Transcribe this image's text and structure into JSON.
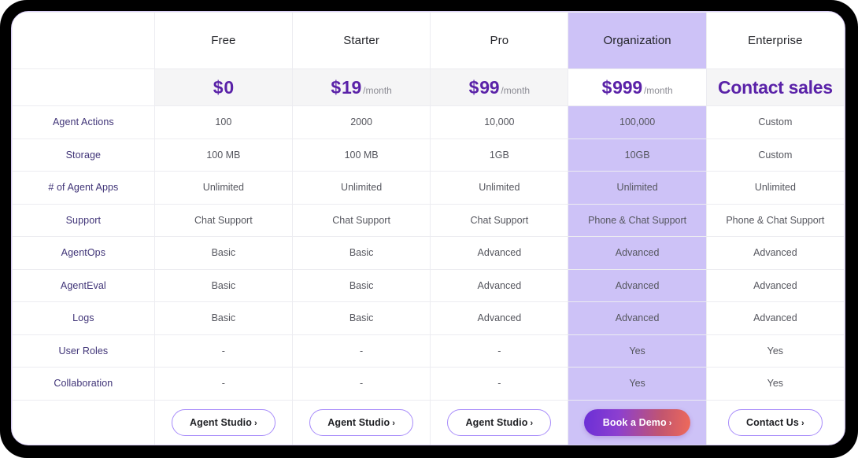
{
  "table": {
    "label_column_header": "",
    "plans": [
      {
        "name": "Free",
        "highlight": false,
        "currency": "$",
        "amount": "0",
        "period": "",
        "contact_text": ""
      },
      {
        "name": "Starter",
        "highlight": false,
        "currency": "$",
        "amount": "19",
        "period": "/month",
        "contact_text": ""
      },
      {
        "name": "Pro",
        "highlight": false,
        "currency": "$",
        "amount": "99",
        "period": "/month",
        "contact_text": ""
      },
      {
        "name": "Organization",
        "highlight": true,
        "currency": "$",
        "amount": "999",
        "period": "/month",
        "contact_text": ""
      },
      {
        "name": "Enterprise",
        "highlight": false,
        "currency": "",
        "amount": "",
        "period": "",
        "contact_text": "Contact sales"
      }
    ],
    "features": [
      {
        "label": "Agent Actions",
        "values": [
          "100",
          "2000",
          "10,000",
          "100,000",
          "Custom"
        ]
      },
      {
        "label": "Storage",
        "values": [
          "100 MB",
          "100 MB",
          "1GB",
          "10GB",
          "Custom"
        ]
      },
      {
        "label": "# of Agent Apps",
        "values": [
          "Unlimited",
          "Unlimited",
          "Unlimited",
          "Unlimited",
          "Unlimited"
        ]
      },
      {
        "label": "Support",
        "values": [
          "Chat Support",
          "Chat Support",
          "Chat Support",
          "Phone & Chat Support",
          "Phone & Chat Support"
        ]
      },
      {
        "label": "AgentOps",
        "values": [
          "Basic",
          "Basic",
          "Advanced",
          "Advanced",
          "Advanced"
        ]
      },
      {
        "label": "AgentEval",
        "values": [
          "Basic",
          "Basic",
          "Advanced",
          "Advanced",
          "Advanced"
        ]
      },
      {
        "label": "Logs",
        "values": [
          "Basic",
          "Basic",
          "Advanced",
          "Advanced",
          "Advanced"
        ]
      },
      {
        "label": "User Roles",
        "values": [
          "-",
          "-",
          "-",
          "Yes",
          "Yes"
        ]
      },
      {
        "label": "Collaboration",
        "values": [
          "-",
          "-",
          "-",
          "Yes",
          "Yes"
        ]
      }
    ],
    "cta": [
      {
        "label": "Agent Studio",
        "chevron": "›",
        "style": "outline"
      },
      {
        "label": "Agent Studio",
        "chevron": "›",
        "style": "outline"
      },
      {
        "label": "Agent Studio",
        "chevron": "›",
        "style": "outline"
      },
      {
        "label": "Book a Demo",
        "chevron": "›",
        "style": "gradient"
      },
      {
        "label": "Contact Us",
        "chevron": "›",
        "style": "outline"
      }
    ]
  },
  "colors": {
    "highlight_bg": "#cdc2f7",
    "price_row_bg": "#f5f5f6",
    "price_text": "#5a22a8",
    "feature_label_text": "#3f3377",
    "border": "#ececf1",
    "frame_border": "#d9cdf7",
    "bezel": "#000000",
    "gradient_start": "#6b2fd6",
    "gradient_end": "#ef6a5a",
    "outline_button_border": "#a78bfa"
  }
}
